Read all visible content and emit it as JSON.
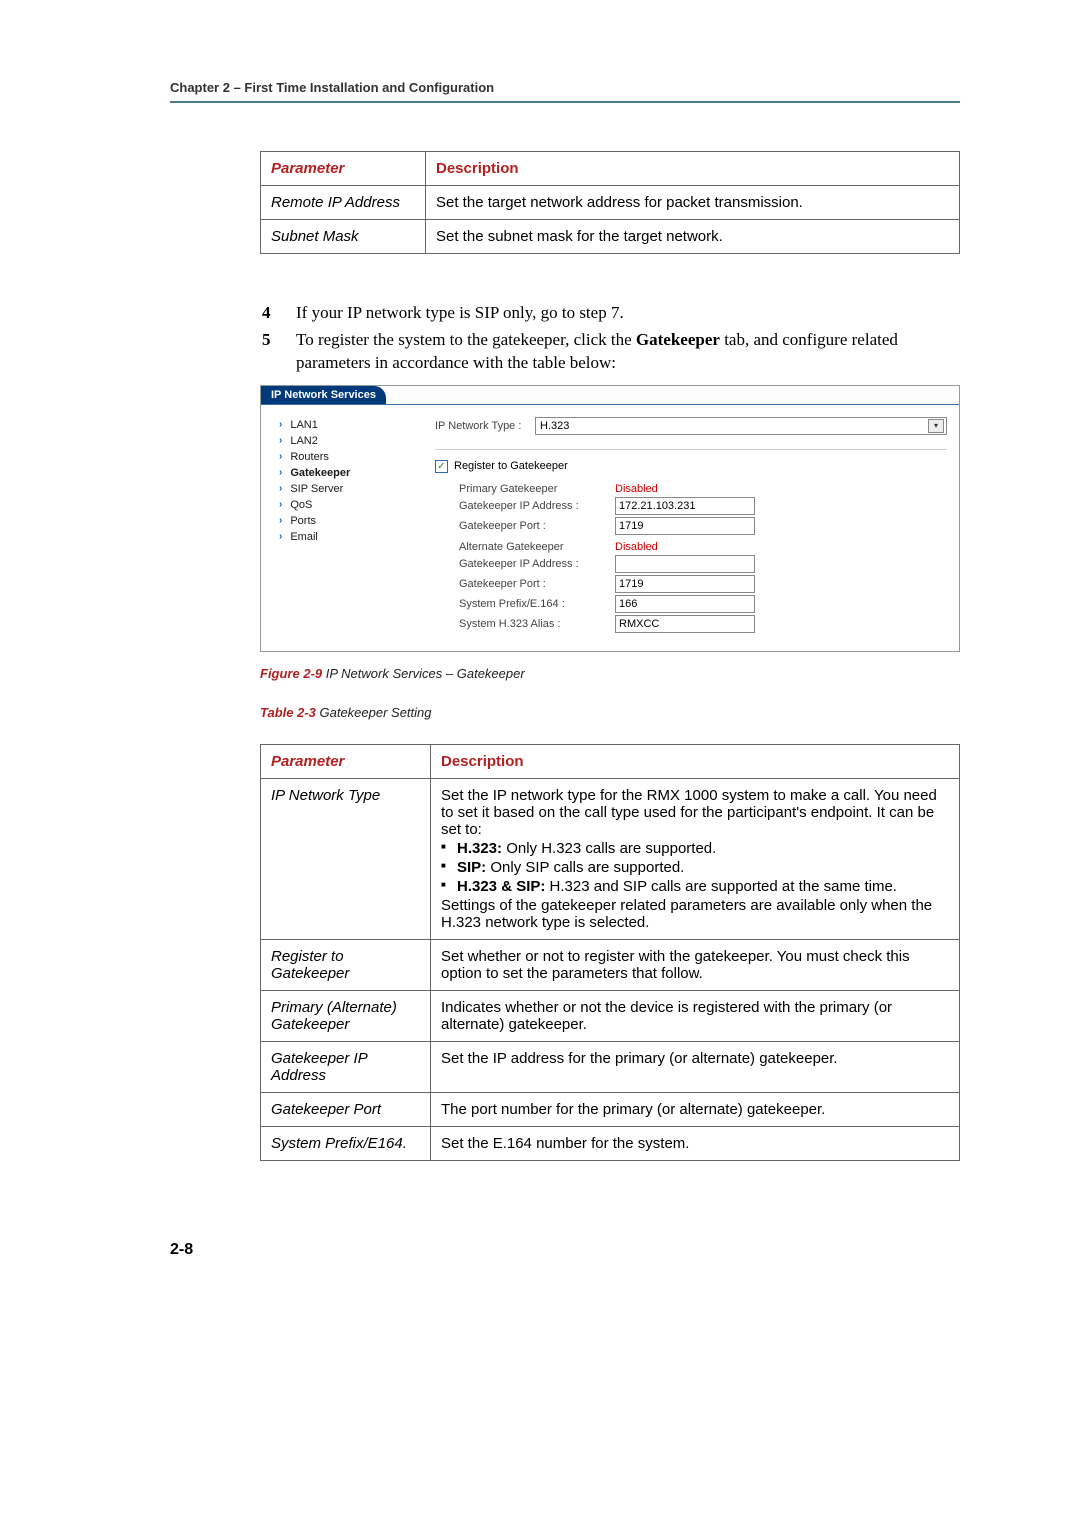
{
  "header": "Chapter 2 – First Time Installation and Configuration",
  "table1": {
    "head_param": "Parameter",
    "head_desc": "Description",
    "rows": [
      {
        "param": "Remote IP Address",
        "desc": "Set the target network address for packet transmission."
      },
      {
        "param": "Subnet Mask",
        "desc": "Set the subnet mask for the target network."
      }
    ]
  },
  "steps": {
    "s4_num": "4",
    "s4_text": "If your IP network type is SIP only, go to step 7.",
    "s5_num": "5",
    "s5_pre": "To register the system to the gatekeeper, click the ",
    "s5_bold": "Gatekeeper",
    "s5_post": " tab, and configure related parameters in accordance with the table below:"
  },
  "dialog": {
    "tab": "IP Network Services",
    "nav": [
      "LAN1",
      "LAN2",
      "Routers",
      "Gatekeeper",
      "SIP Server",
      "QoS",
      "Ports",
      "Email"
    ],
    "nav_active_index": 3,
    "ip_type_label": "IP Network Type :",
    "ip_type_value": "H.323",
    "register_label": "Register to Gatekeeper",
    "primary_label": "Primary Gatekeeper",
    "primary_status": "Disabled",
    "gk_ip_label": "Gatekeeper IP Address :",
    "gk_ip_value": "172.21.103.231",
    "gk_port_label": "Gatekeeper Port :",
    "gk_port_value": "1719",
    "alt_label": "Alternate Gatekeeper",
    "alt_status": "Disabled",
    "alt_ip_value": "",
    "alt_port_value": "1719",
    "prefix_label": "System Prefix/E.164 :",
    "prefix_value": "166",
    "alias_label": "System H.323 Alias :",
    "alias_value": "RMXCC"
  },
  "fig": {
    "label": "Figure 2-9",
    "text": " IP Network Services – Gatekeeper"
  },
  "tbl_caption": {
    "label": "Table 2-3",
    "text": " Gatekeeper Setting"
  },
  "table2": {
    "head_param": "Parameter",
    "head_desc": "Description",
    "r1_param": "IP Network Type",
    "r1_intro": "Set the IP network type for the RMX 1000 system to make a call. You need to set it based on the call type used for the participant's endpoint. It can be set to:",
    "r1_b1_b": "H.323:",
    "r1_b1_t": " Only H.323 calls are supported.",
    "r1_b2_b": "SIP:",
    "r1_b2_t": " Only SIP calls are supported.",
    "r1_b3_b": "H.323 & SIP:",
    "r1_b3_t": " H.323 and SIP calls are supported at the same time.",
    "r1_outro": "Settings of the gatekeeper related parameters are available only when the H.323 network type is selected.",
    "r2_param": "Register to Gatekeeper",
    "r2_desc": "Set whether or not to register with the gatekeeper. You must check this option to set the parameters that follow.",
    "r3_param": "Primary (Alternate) Gatekeeper",
    "r3_desc": "Indicates whether or not the device is registered with the primary (or alternate) gatekeeper.",
    "r4_param": "Gatekeeper IP Address",
    "r4_desc": "Set the IP address for the primary (or alternate) gatekeeper.",
    "r5_param": "Gatekeeper Port",
    "r5_desc": "The port number for the primary (or alternate) gatekeeper.",
    "r6_param": "System Prefix/E164.",
    "r6_desc": "Set the E.164 number for the system."
  },
  "footer": "2-8"
}
